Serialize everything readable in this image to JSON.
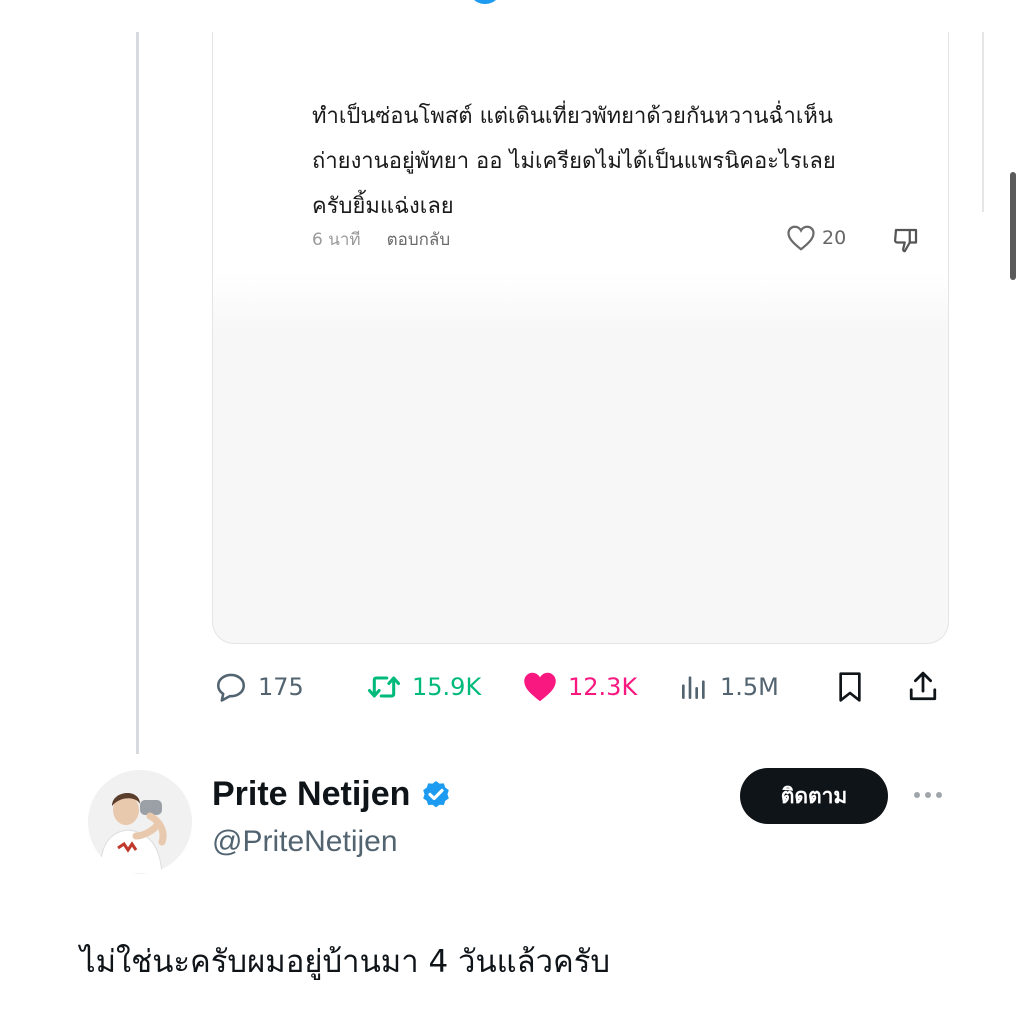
{
  "comment": {
    "lines": "ทำเป็นซ่อนโพสต์ แต่เดินเที่ยวพัทยาด้วยกันหวานฉ่ำเห็น\nถ่ายงานอยู่พัทยา ออ ไม่เครียดไม่ได้เป็นแพรนิคอะไรเลย\nครับยิ้มแฉ่งเลย",
    "time": "6 นาที",
    "reply_label": "ตอบกลับ",
    "like_count": "20"
  },
  "actions": {
    "replies": "175",
    "reposts": "15.9K",
    "likes": "12.3K",
    "views": "1.5M"
  },
  "author": {
    "display_name": "Prite Netijen",
    "handle": "@PriteNetijen",
    "verified": true
  },
  "follow_label": "ติดตาม",
  "post": {
    "text": "ไม่ใช่นะครับผมอยู่บ้านมา 4 วันแล้วครับ"
  },
  "colors": {
    "accent": "#1d9bf0",
    "repost": "#00ba7c",
    "like": "#f91880",
    "text_primary": "#0f1419",
    "text_secondary": "#536471"
  },
  "icons": [
    "comment-icon",
    "repost-icon",
    "heart-icon",
    "views-icon",
    "bookmark-icon",
    "share-icon",
    "verified-badge-icon",
    "more-icon",
    "heart-outline-icon",
    "dislike-icon"
  ]
}
